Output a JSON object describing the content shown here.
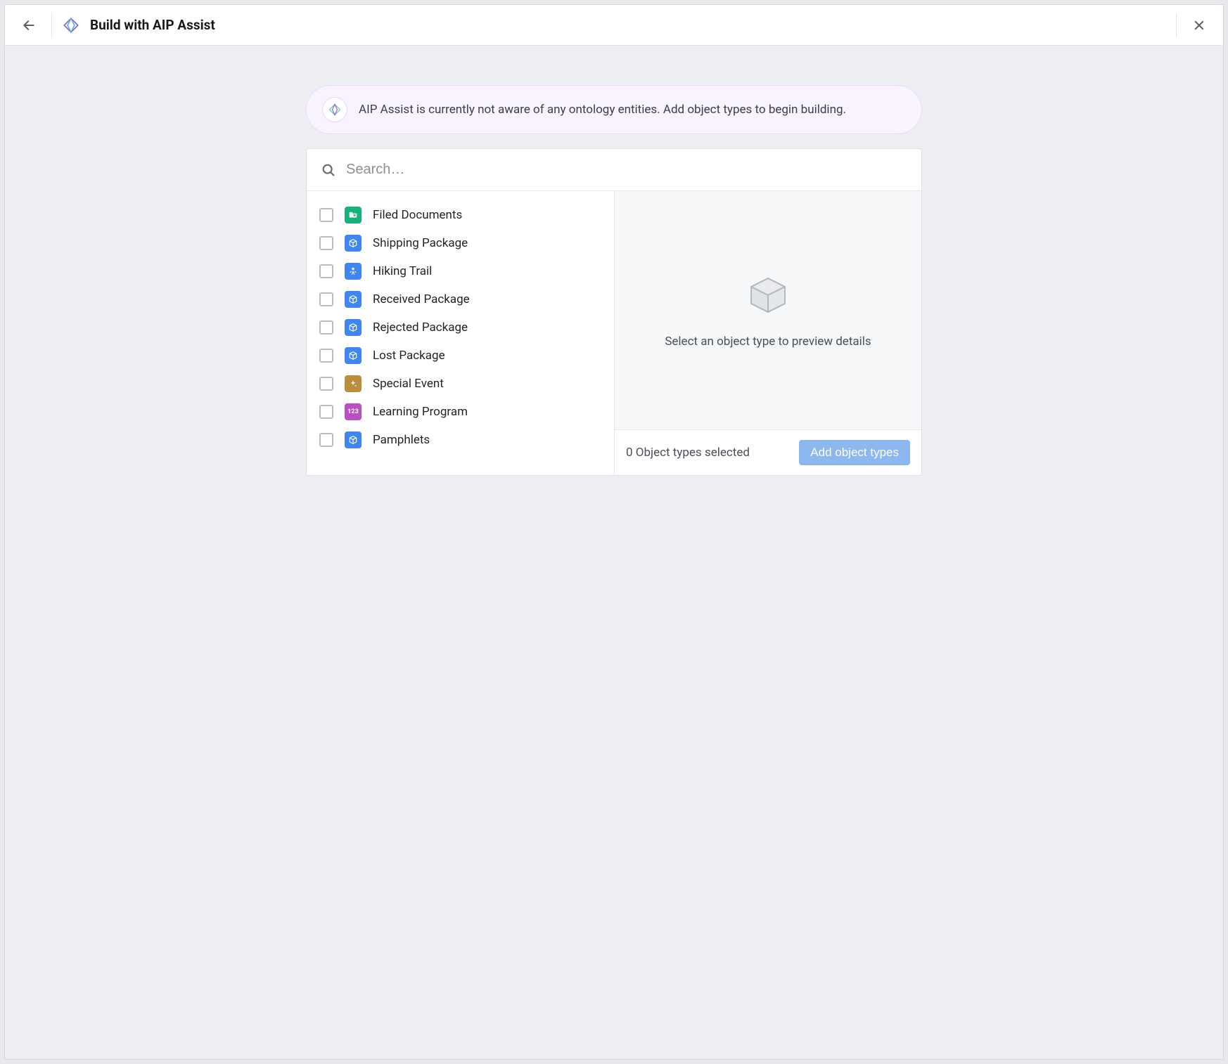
{
  "header": {
    "title": "Build with AIP Assist"
  },
  "notice": {
    "text": "AIP Assist is currently not aware of any ontology entities. Add object types to begin building."
  },
  "search": {
    "placeholder": "Search…"
  },
  "object_types": [
    {
      "label": "Filed Documents",
      "icon": "folder",
      "color": "green"
    },
    {
      "label": "Shipping Package",
      "icon": "box",
      "color": "blue"
    },
    {
      "label": "Hiking Trail",
      "icon": "person",
      "color": "blue"
    },
    {
      "label": "Received Package",
      "icon": "box",
      "color": "blue"
    },
    {
      "label": "Rejected Package",
      "icon": "box",
      "color": "blue"
    },
    {
      "label": "Lost Package",
      "icon": "box",
      "color": "blue"
    },
    {
      "label": "Special Event",
      "icon": "sparkle",
      "color": "brown"
    },
    {
      "label": "Learning Program",
      "icon": "num",
      "color": "purple"
    },
    {
      "label": "Pamphlets",
      "icon": "box",
      "color": "blue"
    }
  ],
  "preview": {
    "empty_message": "Select an object type to preview details"
  },
  "footer": {
    "selected_text": "0 Object types selected",
    "add_button_label": "Add object types"
  }
}
